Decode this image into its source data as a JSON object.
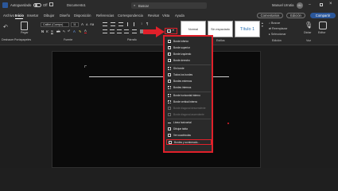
{
  "titlebar": {
    "autosave_label": "Autoguardado",
    "toggle_state": "Off",
    "doc_title": "Documento1",
    "search_placeholder": "Buscar",
    "user_name": "Manuel Urrutia",
    "user_initials": "MU"
  },
  "menubar": {
    "tabs": [
      "Archivo",
      "Inicio",
      "Insertar",
      "Dibujar",
      "Diseño",
      "Disposición",
      "Referencias",
      "Correspondencia",
      "Revisar",
      "Vista",
      "Ayuda"
    ],
    "comments_label": "Comentarios",
    "editing_label": "Edición",
    "share_label": "Compartir"
  },
  "ribbon": {
    "paste_label": "Pegar",
    "clipboard_label": "Portapapeles",
    "undo_label": "Deshacer",
    "font_name": "Calibri (Cuerpo)",
    "font_size": "11",
    "font_group_label": "Fuente",
    "paragraph_label": "Párrafo",
    "styles_label": "Estilos",
    "styles": [
      "Normal",
      "Sin espaciado",
      "Título 1"
    ],
    "find_label": "Buscar",
    "replace_label": "Reemplazar",
    "select_label": "Seleccionar",
    "edit_group_label": "Edición",
    "dictate_label": "Dictar",
    "voice_label": "Voz",
    "editor_label": "Editor"
  },
  "border_menu": {
    "items": [
      {
        "label": "Borde inferior",
        "disabled": false
      },
      {
        "label": "Borde superior",
        "disabled": false
      },
      {
        "label": "Borde izquierdo",
        "disabled": false
      },
      {
        "label": "Borde derecho",
        "disabled": false
      },
      {
        "label": "Sin borde",
        "disabled": false
      },
      {
        "label": "Todos los bordes",
        "disabled": false
      },
      {
        "label": "Bordes externos",
        "disabled": false
      },
      {
        "label": "Bordes internos",
        "disabled": false
      },
      {
        "label": "Borde horizontal interno",
        "disabled": false
      },
      {
        "label": "Borde vertical interno",
        "disabled": false
      },
      {
        "label": "Borde diagonal descendente",
        "disabled": true
      },
      {
        "label": "Borde diagonal ascendente",
        "disabled": true
      },
      {
        "label": "Línea horizontal",
        "disabled": false
      },
      {
        "label": "Dibujar tabla",
        "disabled": false
      },
      {
        "label": "Ver cuadrículas",
        "disabled": false
      },
      {
        "label": "Bordes y sombreado...",
        "disabled": false
      }
    ]
  },
  "colors": {
    "accent": "#e0202a",
    "brand": "#2b579a"
  }
}
